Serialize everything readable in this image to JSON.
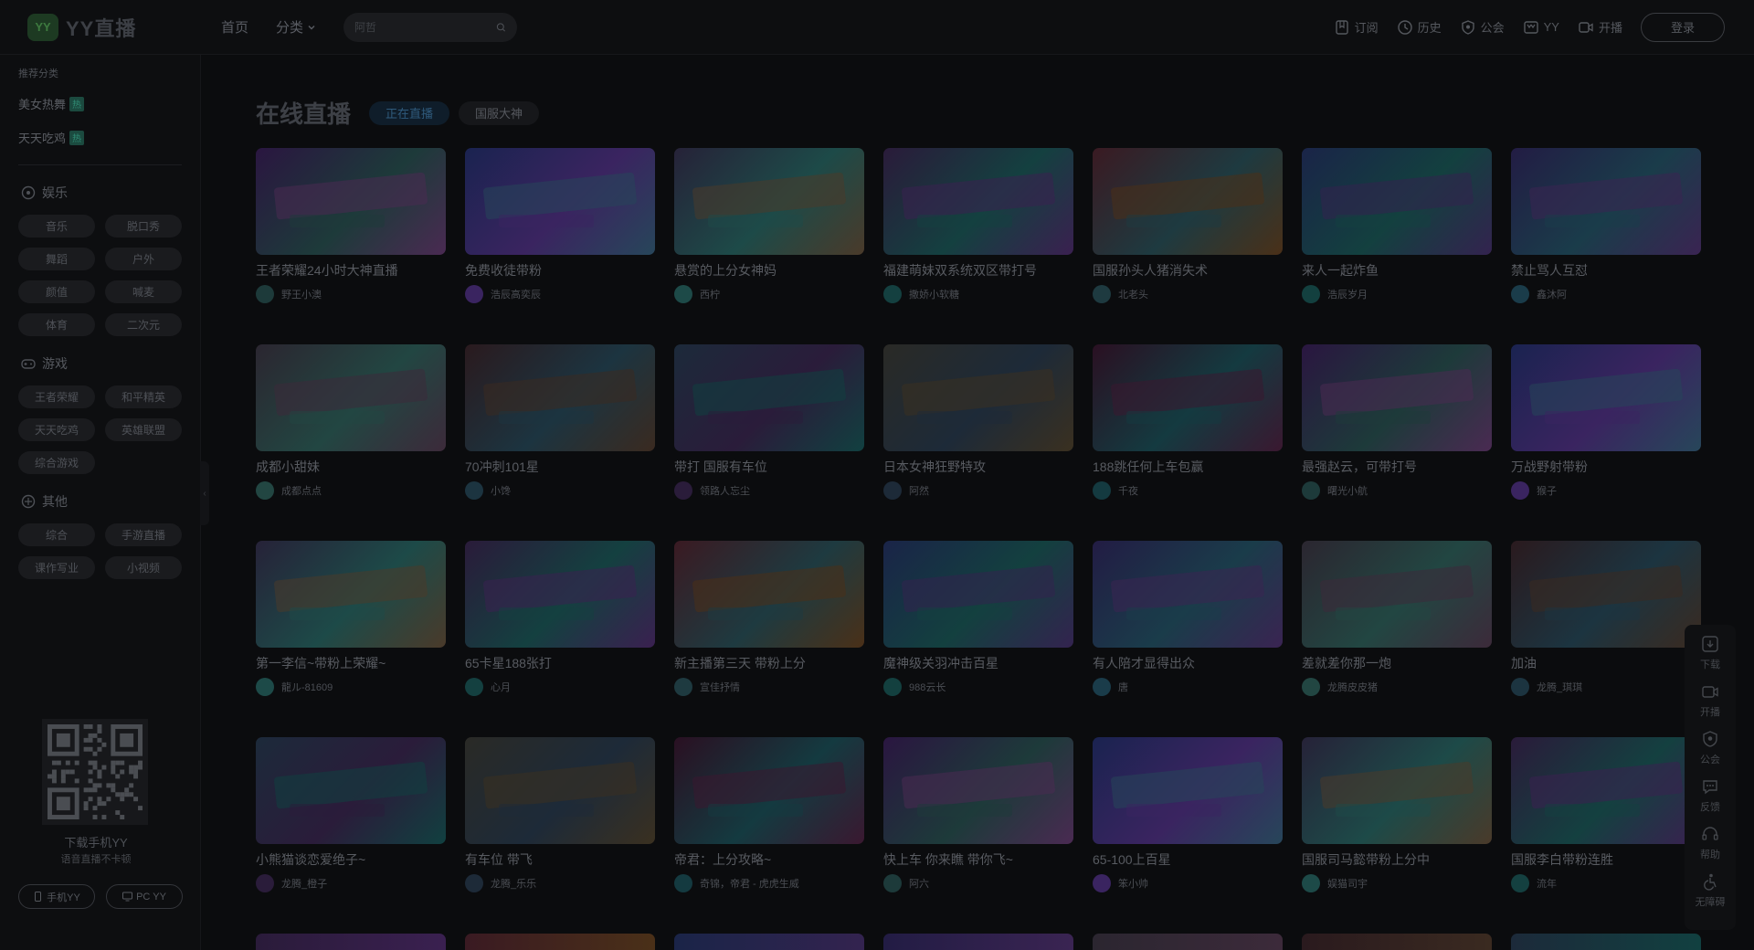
{
  "header": {
    "logo_mark": "YY",
    "logo_text": "YY直播",
    "nav": [
      {
        "label": "首页"
      },
      {
        "label": "分类"
      }
    ],
    "search_placeholder": "阿哲",
    "right_items": [
      {
        "label": "订阅",
        "icon": "bookmark-icon"
      },
      {
        "label": "历史",
        "icon": "clock-icon"
      },
      {
        "label": "公会",
        "icon": "shield-icon"
      },
      {
        "label": "YY",
        "icon": "yy-box-icon"
      },
      {
        "label": "开播",
        "icon": "camera-icon"
      }
    ],
    "login_label": "登录"
  },
  "sidebar": {
    "caption": "推荐分类",
    "recommended": [
      {
        "label": "美女热舞",
        "badge": "热"
      },
      {
        "label": "天天吃鸡",
        "badge": "热"
      }
    ],
    "sections": [
      {
        "title": "娱乐",
        "icon": "music-icon",
        "items": [
          "音乐",
          "脱口秀",
          "舞蹈",
          "户外",
          "颜值",
          "喊麦",
          "体育",
          "二次元"
        ]
      },
      {
        "title": "游戏",
        "icon": "gamepad-icon",
        "items": [
          "王者荣耀",
          "和平精英",
          "天天吃鸡",
          "英雄联盟",
          "综合游戏"
        ]
      },
      {
        "title": "其他",
        "icon": "grid-icon",
        "items": [
          "综合",
          "手游直播",
          "课作写业",
          "小视频"
        ]
      }
    ],
    "qr_caption": "下载手机YY",
    "qr_sub": "语音直播不卡顿",
    "download_buttons": [
      {
        "label": "手机YY",
        "icon": "phone-icon"
      },
      {
        "label": "PC YY",
        "icon": "monitor-icon"
      }
    ]
  },
  "main": {
    "section_title": "在线直播",
    "tabs": [
      {
        "label": "正在直播",
        "active": true
      },
      {
        "label": "国服大神",
        "active": false
      }
    ],
    "cards": [
      {
        "title": "王者荣耀24小时大神直播",
        "anchor": "野王小澳"
      },
      {
        "title": "免费收徒带粉",
        "anchor": "浩辰高奕辰"
      },
      {
        "title": "悬赏的上分女神妈",
        "anchor": "西柠"
      },
      {
        "title": "福建萌妹双系统双区带打号",
        "anchor": "撒娇小软糖"
      },
      {
        "title": "国服孙头人猪消失术",
        "anchor": "北老头"
      },
      {
        "title": "来人一起炸鱼",
        "anchor": "浩辰岁月"
      },
      {
        "title": "禁止骂人互怼",
        "anchor": "鑫沐阿"
      },
      {
        "title": "成都小甜妹",
        "anchor": "成都点点"
      },
      {
        "title": "70冲刺101星",
        "anchor": "小馋"
      },
      {
        "title": "带打 国服有车位",
        "anchor": "领路人忘尘"
      },
      {
        "title": "日本女神狂野特攻",
        "anchor": "阿然"
      },
      {
        "title": "188跳任何上车包赢",
        "anchor": "千夜"
      },
      {
        "title": "最强赵云，可带打号",
        "anchor": "曙光小航"
      },
      {
        "title": "万战野射带粉",
        "anchor": "猴子"
      },
      {
        "title": "第一李信~带粉上荣耀~",
        "anchor": "龍ル-81609"
      },
      {
        "title": "65卡星188张打",
        "anchor": "心月"
      },
      {
        "title": "新主播第三天 带粉上分",
        "anchor": "宣佳抒情"
      },
      {
        "title": "魔神级关羽冲击百星",
        "anchor": "988云长"
      },
      {
        "title": "有人陪才显得出众",
        "anchor": "唐"
      },
      {
        "title": "差就差你那一炮",
        "anchor": "龙腾皮皮猪"
      },
      {
        "title": "加油",
        "anchor": "龙腾_琪琪"
      },
      {
        "title": "小熊猫谈恋爱绝子~",
        "anchor": "龙腾_橙子"
      },
      {
        "title": "有车位 带飞",
        "anchor": "龙腾_乐乐"
      },
      {
        "title": "帝君：上分攻略~",
        "anchor": "奇锦，帝君 - 虎虎生威"
      },
      {
        "title": "快上车 你来瞧 带你飞~",
        "anchor": "阿六"
      },
      {
        "title": "65-100上百星",
        "anchor": "笨小帅"
      },
      {
        "title": "国服司马懿带粉上分中",
        "anchor": "娱猫司宇"
      },
      {
        "title": "国服李白带粉连胜",
        "anchor": "流年"
      }
    ]
  },
  "float_bar": [
    {
      "label": "下载",
      "icon": "download-icon"
    },
    {
      "label": "开播",
      "icon": "video-icon"
    },
    {
      "label": "公会",
      "icon": "shield-icon"
    },
    {
      "label": "反馈",
      "icon": "message-icon"
    },
    {
      "label": "帮助",
      "icon": "headset-icon"
    },
    {
      "label": "无障碍",
      "icon": "accessibility-icon"
    }
  ],
  "colors": {
    "brand": "#3d7a3f",
    "tab_active_text": "#2f5a7c",
    "hot_badge": "#2f8a73"
  }
}
